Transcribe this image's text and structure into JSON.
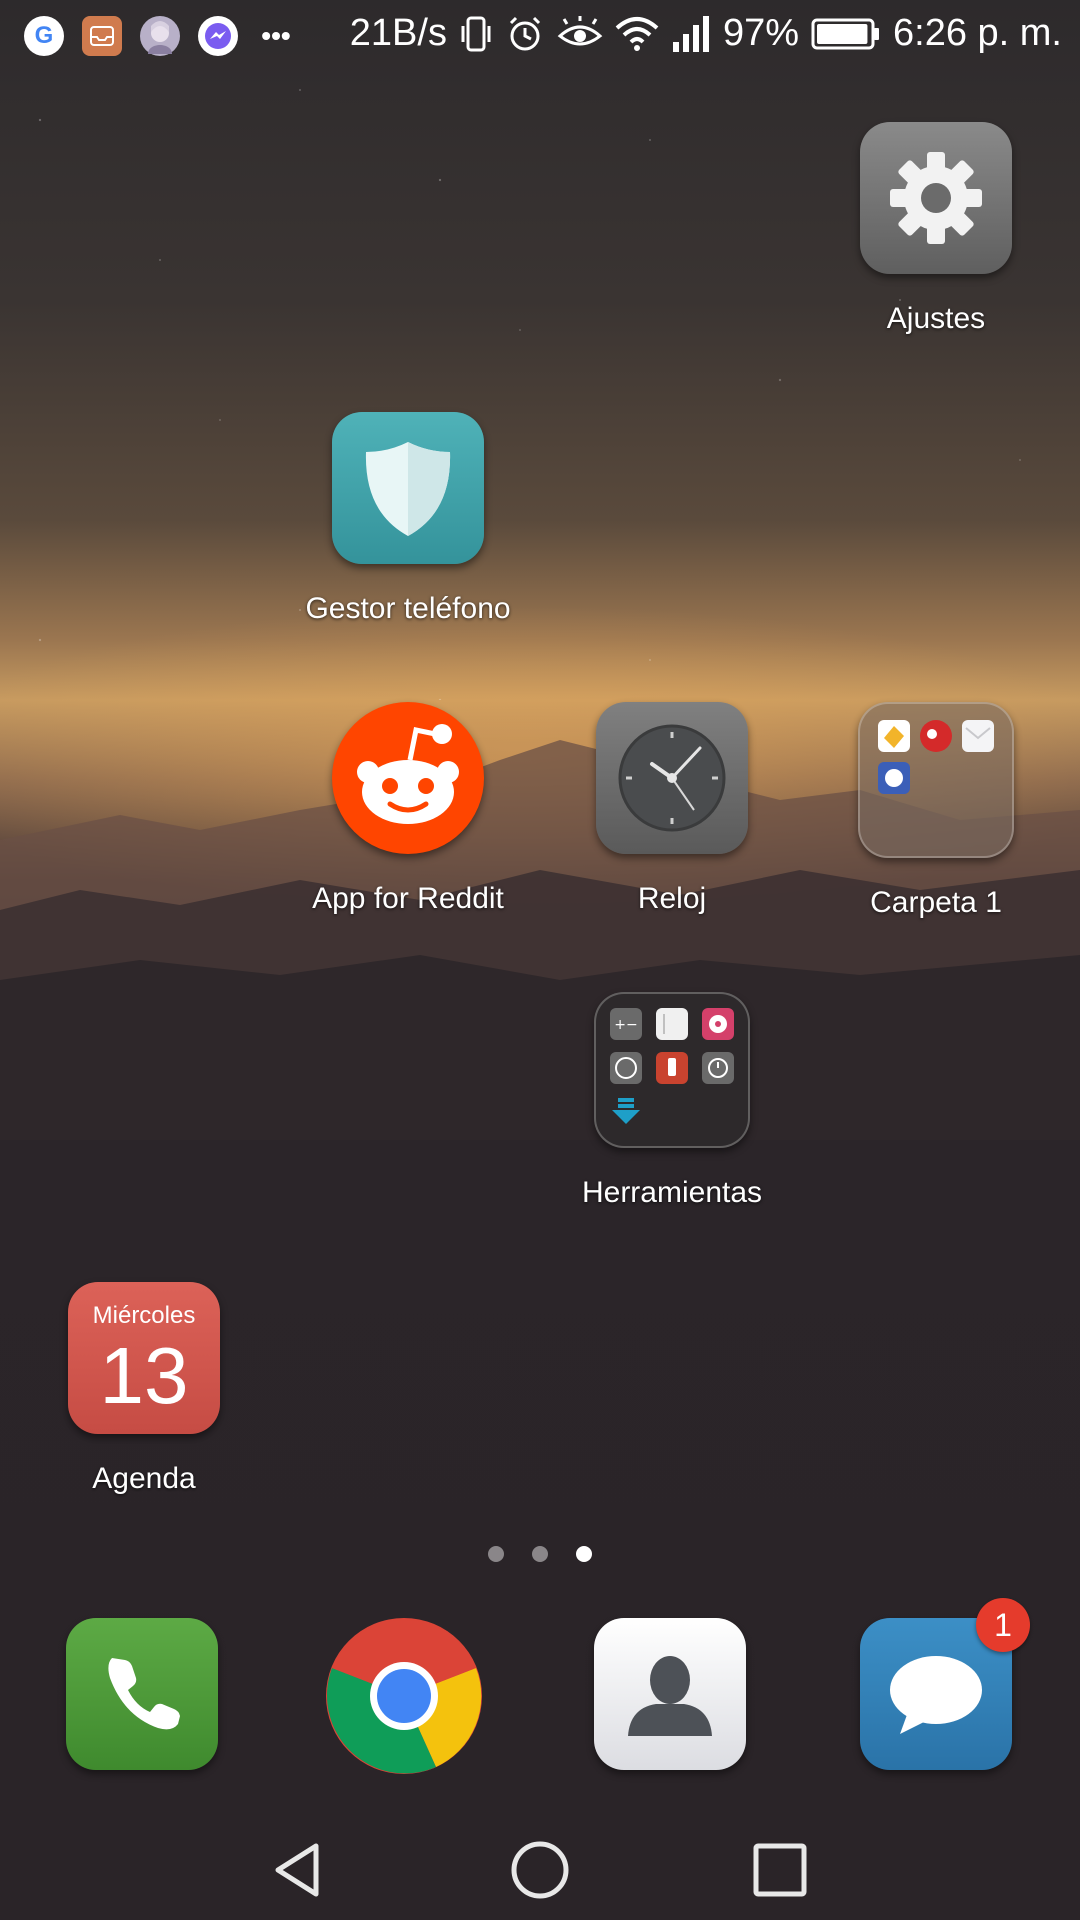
{
  "status_bar": {
    "network_speed": "21B/s",
    "battery_percent": "97%",
    "time": "6:26 p. m.",
    "battery_level": 0.97,
    "notification_icons": [
      "google-icon",
      "inbox-icon",
      "avatar-icon",
      "messenger-icon",
      "more-icon"
    ],
    "system_icons": [
      "vibrate-icon",
      "alarm-icon",
      "eye-comfort-icon",
      "wifi-icon",
      "signal-icon",
      "battery-icon"
    ]
  },
  "home": {
    "apps": [
      {
        "id": "ajustes",
        "label": "Ajustes",
        "icon": "gear-icon"
      },
      {
        "id": "gestor",
        "label": "Gestor teléfono",
        "icon": "shield-icon"
      },
      {
        "id": "reddit",
        "label": "App for Reddit",
        "icon": "reddit-icon"
      },
      {
        "id": "reloj",
        "label": "Reloj",
        "icon": "clock-icon"
      },
      {
        "id": "carpeta",
        "label": "Carpeta 1",
        "icon": "folder-icon"
      },
      {
        "id": "herramientas",
        "label": "Herramientas",
        "icon": "folder-icon"
      },
      {
        "id": "agenda",
        "label": "Agenda",
        "icon": "calendar-icon"
      }
    ],
    "calendar": {
      "weekday": "Miércoles",
      "day": "13"
    },
    "page_indicator": {
      "pages": 3,
      "current": 3
    }
  },
  "dock": {
    "apps": [
      {
        "id": "phone",
        "icon": "phone-icon"
      },
      {
        "id": "chrome",
        "icon": "chrome-icon"
      },
      {
        "id": "contacts",
        "icon": "contacts-icon"
      },
      {
        "id": "messages",
        "icon": "messages-icon",
        "badge": "1"
      }
    ]
  },
  "nav_bar": {
    "buttons": [
      "back-icon",
      "home-icon",
      "recents-icon"
    ]
  },
  "colors": {
    "reddit": "#ff4500",
    "badge": "#e53b2c",
    "phone": "#4e9a3a",
    "messages": "#2f80b8",
    "shield_tile": "#3fa0a8",
    "calendar": "#d0564c"
  }
}
